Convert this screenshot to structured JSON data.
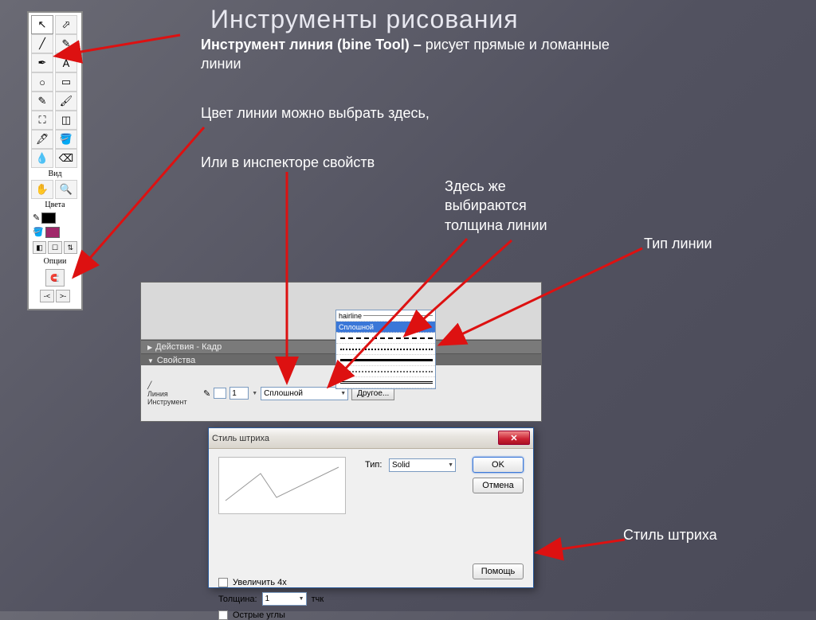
{
  "slide": {
    "title": "Инструменты рисования"
  },
  "intro": {
    "bold": "Инструмент линия (bine Tool) –",
    "rest": " рисует прямые и ломанные линии"
  },
  "text1": "Цвет линии можно выбрать здесь,",
  "text2": "Или в инспекторе свойств",
  "callout_thickness": "Здесь же выбираются толщина линии",
  "callout_linetype": "Тип линии",
  "callout_strokestyle": "Стиль штриха",
  "palette": {
    "vid": "Вид",
    "cveta": "Цвета",
    "opcii": "Опции"
  },
  "properties": {
    "tab1": "Действия - Кадр",
    "tab2": "Свойства",
    "tool_line1": "Линия",
    "tool_line2": "Инструмент",
    "thickness_value": "1",
    "style_value": "Сплошной",
    "other_btn": "Другое..."
  },
  "style_popup": {
    "opt_hairline": "hairline",
    "opt_solid": "Сплошной"
  },
  "dialog": {
    "title": "Стиль штриха",
    "type_label": "Тип:",
    "type_value": "Solid",
    "ok": "OK",
    "cancel": "Отмена",
    "zoom4x": "Увеличить 4x",
    "thickness_label": "Толщина:",
    "thickness_value": "1",
    "thickness_unit": "тчк",
    "sharp_corners": "Острые углы",
    "help": "Помощь"
  }
}
